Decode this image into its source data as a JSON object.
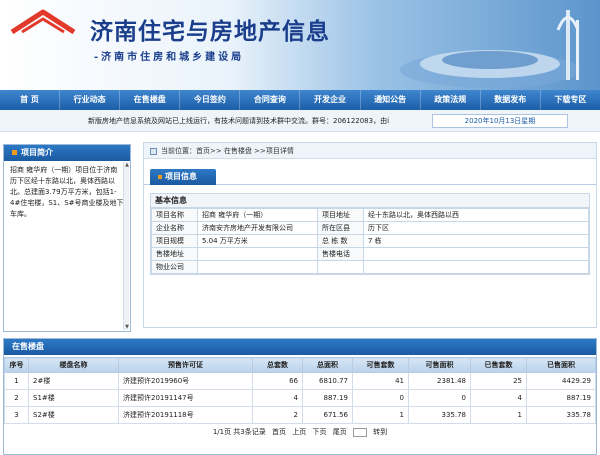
{
  "site": {
    "title": "济南住宅与房地产信息",
    "subtitle": "-济南市住房和城乡建设局"
  },
  "nav": [
    {
      "label": "首 页"
    },
    {
      "label": "行业动态"
    },
    {
      "label": "在售楼盘"
    },
    {
      "label": "今日签约"
    },
    {
      "label": "合同查询"
    },
    {
      "label": "开发企业"
    },
    {
      "label": "通知公告"
    },
    {
      "label": "政策法规"
    },
    {
      "label": "数据发布"
    },
    {
      "label": "下载专区"
    }
  ],
  "notice": {
    "text": "新版房地产信息系统及网站已上线运行，有技术问题请到技术群中交流。群号：206122083，由i",
    "date": "2020年10月13日星期"
  },
  "side": {
    "title": "项目简介",
    "body": "招商 雍华府（一期）项目位于济南历下区经十东路以北，奥体西路以北。总建面3.79万平方米，包括1-4#住宅楼，S1、S#号商业楼及地下车库。"
  },
  "breadcrumb": "当前位置：首页>> 在售楼盘 >>项目详情",
  "project_tab": "项目信息",
  "basic": {
    "title": "基本信息",
    "rows": [
      {
        "k1": "项目名称",
        "v1": "招商 雍华府（一期）",
        "k2": "项目地址",
        "v2": "经十东路以北，奥体西路以西"
      },
      {
        "k1": "企业名称",
        "v1": "济南安齐房地产开发有限公司",
        "k2": "所在区县",
        "v2": "历下区"
      },
      {
        "k1": "项目规模",
        "v1": "5.04 万平方米",
        "k2": "总 栋 数",
        "v2": "7 栋"
      },
      {
        "k1": "售楼地址",
        "v1": "",
        "k2": "售楼电话",
        "v2": ""
      },
      {
        "k1": "物业公司",
        "v1": "",
        "k2": "",
        "v2": ""
      }
    ]
  },
  "sale": {
    "title": "在售楼盘",
    "columns": [
      "序号",
      "楼盘名称",
      "预售许可证",
      "总套数",
      "总面积",
      "可售套数",
      "可售面积",
      "已售套数",
      "已售面积"
    ],
    "rows": [
      [
        "1",
        "2#楼",
        "济建预许2019960号",
        "66",
        "6810.77",
        "41",
        "2381.48",
        "25",
        "4429.29"
      ],
      [
        "2",
        "S1#楼",
        "济建预许20191147号",
        "4",
        "887.19",
        "0",
        "0",
        "4",
        "887.19"
      ],
      [
        "3",
        "S2#楼",
        "济建预许20191118号",
        "2",
        "671.56",
        "1",
        "335.78",
        "1",
        "335.78"
      ]
    ],
    "pager": {
      "info": "1/1页 共3条记录",
      "first": "首页",
      "prev": "上页",
      "next": "下页",
      "last": "尾页",
      "goto": "转到"
    }
  },
  "colors": {
    "nav_blue": "#1c5ea8",
    "title_blue": "#1a3e8c",
    "accent_orange": "#f29b1d"
  }
}
